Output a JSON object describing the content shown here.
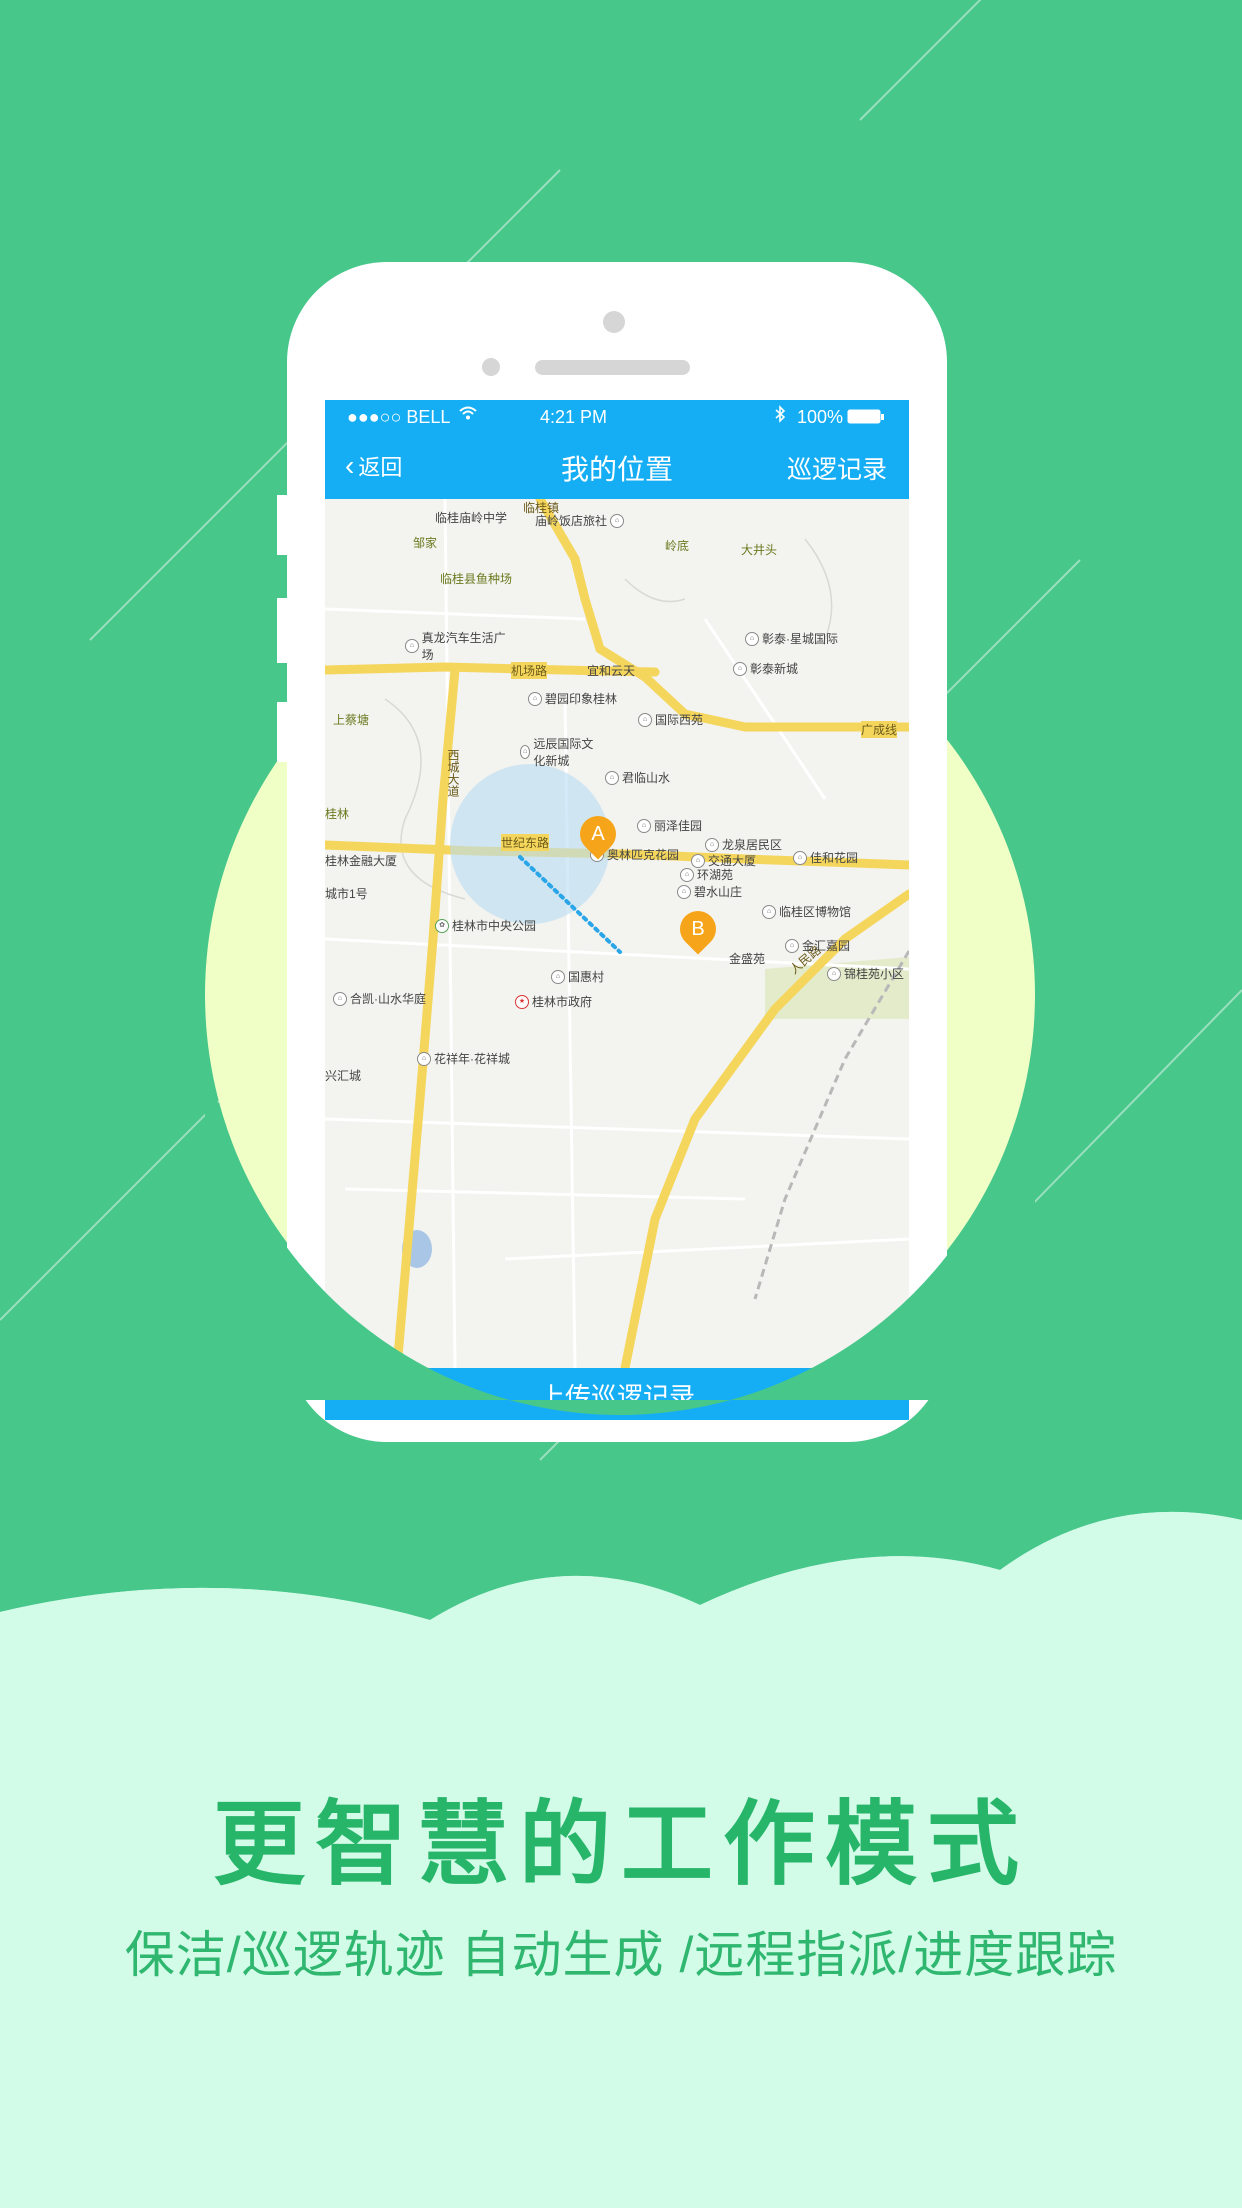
{
  "colors": {
    "background_green": "#47c78a",
    "circle_yellow": "#efffc6",
    "cloud_mint": "#d2fbe8",
    "app_blue": "#15aef4",
    "marker_orange": "#f6a51a",
    "headline_green": "#27b56a"
  },
  "status_bar": {
    "carrier": "●●●○○ BELL",
    "time": "4:21 PM",
    "battery": "100%"
  },
  "nav": {
    "back_label": "返回",
    "title": "我的位置",
    "right_label": "巡逻记录"
  },
  "map": {
    "roads": {
      "airport": "机场路",
      "west_city": "西城大道",
      "century_east": "世纪东路",
      "guangcheng": "广成线",
      "renmin": "人民路",
      "lingui": "临桂镇"
    },
    "places": {
      "lingui_school": "临桂庙岭中学",
      "miaoling_hotel": "庙岭饭店旅社",
      "zoujia": "邹家",
      "lingdi": "岭底",
      "dajingtou": "大井头",
      "fish_farm": "临桂县鱼种场",
      "zhenlong": "真龙汽车生活广场",
      "caitai_star": "彰泰·星城国际",
      "caitai_new": "彰泰新城",
      "yihe": "宜和云天",
      "biyuan": "碧园印象桂林",
      "international": "国际西苑",
      "shangcaitang": "上蔡塘",
      "yuanchen": "远辰国际文化新城",
      "junlin": "君临山水",
      "guilin_left": "桂林",
      "lize": "丽泽佳园",
      "longquan": "龙泉居民区",
      "olympic": "奥林匹克花园",
      "jiaotong": "交通大厦",
      "jiahe": "佳和花园",
      "finance": "桂林金融大厦",
      "huanhu": "环湖苑",
      "bishui": "碧水山庄",
      "city1": "城市1号",
      "museum": "临桂区博物馆",
      "central_park": "桂林市中央公园",
      "jinhui": "金汇嘉园",
      "jinsheng": "金盛苑",
      "jingui": "锦桂苑小区",
      "guohui": "国惠村",
      "hekai": "合凯·山水华庭",
      "government": "桂林市政府",
      "huaxiang": "花祥年·花祥城",
      "xinghui": "兴汇城"
    },
    "marker_a": "A",
    "marker_b": "B"
  },
  "upload_button": "上传巡逻记录",
  "headline": "更智慧的工作模式",
  "subline": "保洁/巡逻轨迹 自动生成 /远程指派/进度跟踪"
}
